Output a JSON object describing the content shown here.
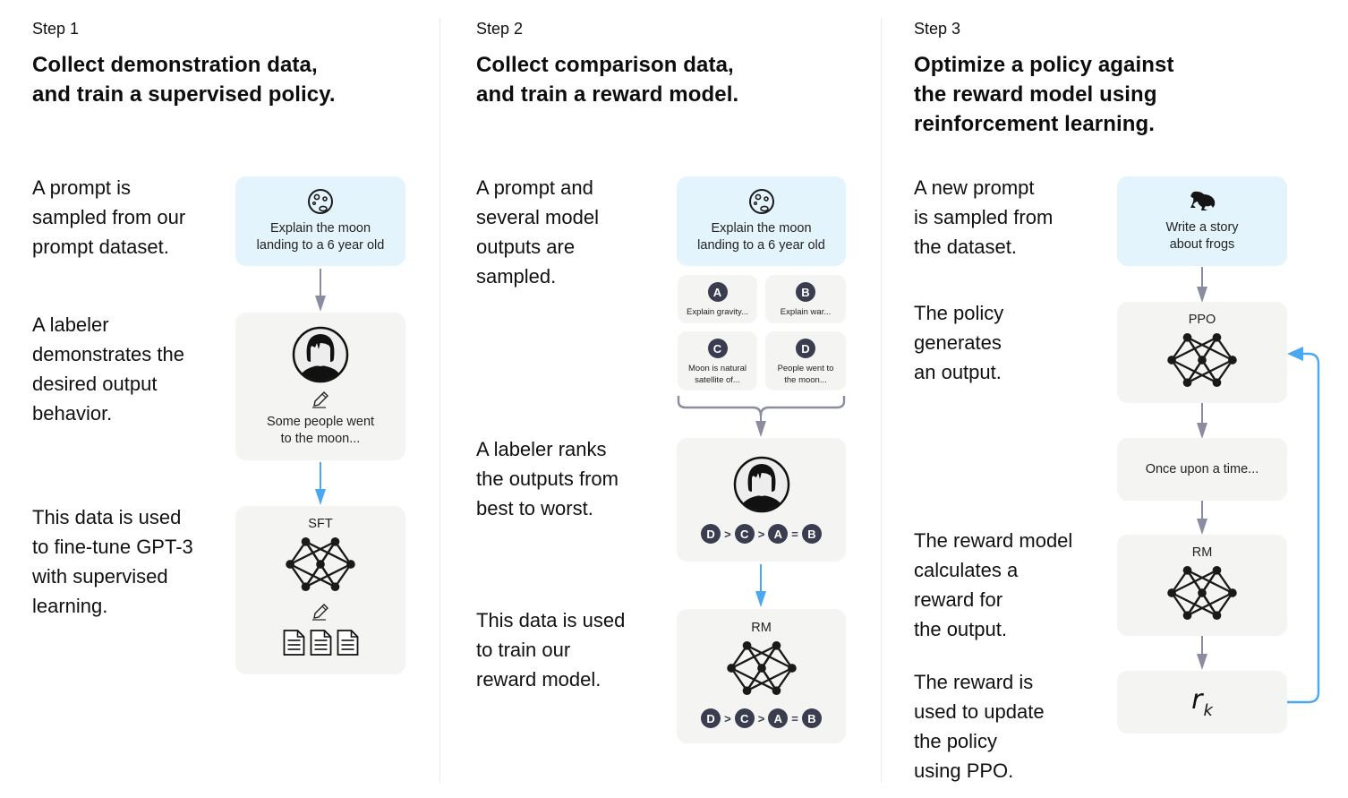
{
  "steps": [
    {
      "label": "Step 1",
      "title": "Collect demonstration data,\nand train a supervised policy.",
      "descriptions": [
        "A prompt is\nsampled from our\nprompt dataset.",
        "A labeler\ndemonstrates the\ndesired output\nbehavior.",
        "This data is used\nto fine-tune GPT-3\nwith supervised\nlearning."
      ],
      "prompt_card": {
        "icon": "moon-icon",
        "text": "Explain the moon\nlanding to a 6 year old"
      },
      "demo_card": {
        "icon": "labeler-avatar",
        "text": "Some people went\nto the moon..."
      },
      "model_card": {
        "label": "SFT",
        "icons": [
          "neural-network-icon",
          "pencil-icon",
          "document-icon",
          "document-icon",
          "document-icon"
        ]
      }
    },
    {
      "label": "Step 2",
      "title": "Collect comparison data,\nand train a reward model.",
      "descriptions": [
        "A prompt and\nseveral model\noutputs are\nsampled.",
        "A labeler ranks\nthe outputs from\nbest to worst.",
        "This data is used\nto train our\nreward model."
      ],
      "prompt_card": {
        "icon": "moon-icon",
        "text": "Explain the moon\nlanding to a 6 year old"
      },
      "outputs": [
        {
          "id": "A",
          "text": "Explain gravity..."
        },
        {
          "id": "B",
          "text": "Explain war..."
        },
        {
          "id": "C",
          "text": "Moon is natural\nsatellite of..."
        },
        {
          "id": "D",
          "text": "People went to\nthe moon..."
        }
      ],
      "ranking": {
        "items": [
          "D",
          "C",
          "A",
          "B"
        ],
        "operators": [
          ">",
          ">",
          "="
        ]
      },
      "model_card": {
        "label": "RM"
      }
    },
    {
      "label": "Step 3",
      "title": "Optimize a policy against\nthe reward model using\nreinforcement learning.",
      "descriptions": [
        "A new prompt\nis sampled from\nthe dataset.",
        "The policy\ngenerates\nan output.",
        "The reward model\ncalculates a\nreward for\nthe output.",
        "The reward is\nused to update\nthe policy\nusing PPO."
      ],
      "prompt_card": {
        "icon": "frog-icon",
        "text": "Write a story\nabout frogs"
      },
      "policy_card": {
        "label": "PPO"
      },
      "output_card": {
        "text": "Once upon a time..."
      },
      "reward_model_card": {
        "label": "RM"
      },
      "reward_card": {
        "symbol": "r",
        "subscript": "k"
      }
    }
  ],
  "colors": {
    "prompt_bg": "#e4f4fd",
    "card_bg": "#f4f4f3",
    "gray_arrow": "#8a8da0",
    "blue_arrow": "#4aa8f0",
    "badge": "#3a3d4f"
  }
}
